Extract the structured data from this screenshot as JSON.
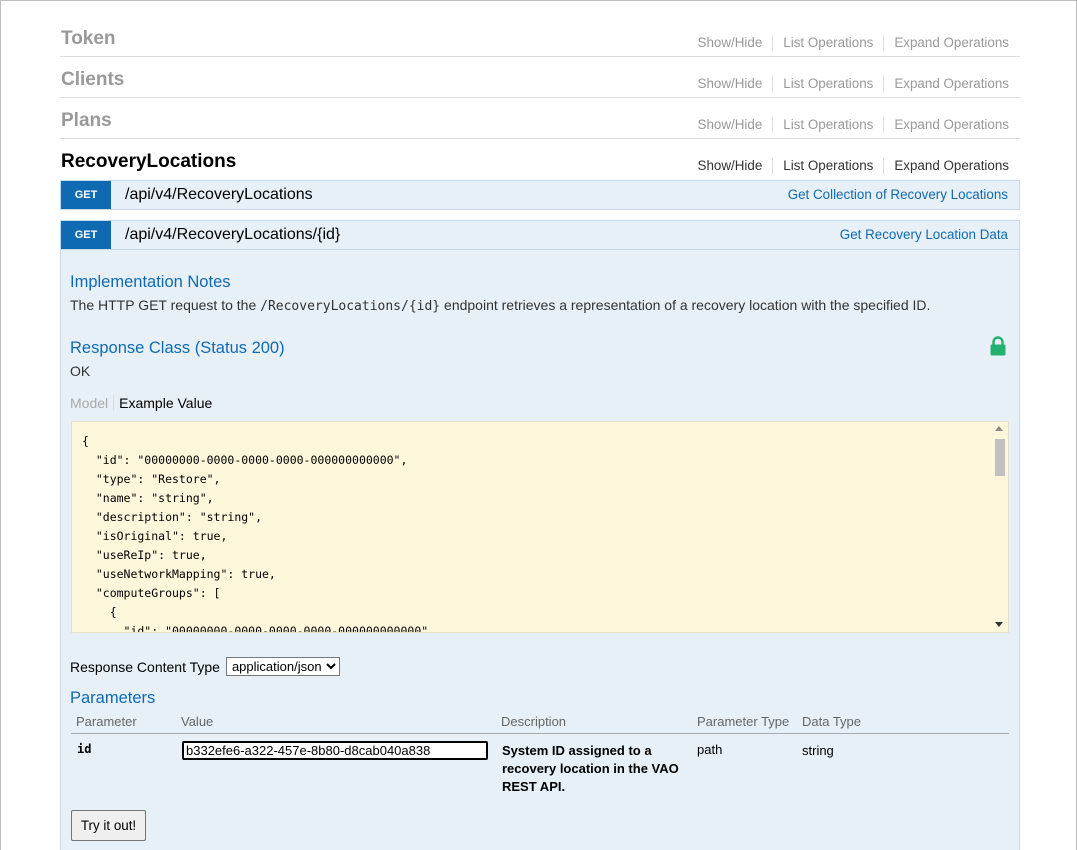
{
  "resources": [
    {
      "name": "Token",
      "active": false
    },
    {
      "name": "Clients",
      "active": false
    },
    {
      "name": "Plans",
      "active": false
    },
    {
      "name": "RecoveryLocations",
      "active": true
    }
  ],
  "resource_actions": {
    "show_hide": "Show/Hide",
    "list_operations": "List Operations",
    "expand_operations": "Expand Operations"
  },
  "operations": [
    {
      "method": "GET",
      "path": "/api/v4/RecoveryLocations",
      "summary": "Get Collection of Recovery Locations"
    },
    {
      "method": "GET",
      "path": "/api/v4/RecoveryLocations/{id}",
      "summary": "Get Recovery Location Data"
    }
  ],
  "implementation": {
    "title": "Implementation Notes",
    "text_before": "The HTTP GET request to the ",
    "code": "/RecoveryLocations/{id}",
    "text_after": " endpoint retrieves a representation of a recovery location with the specified ID."
  },
  "response_class": {
    "title": "Response Class (Status 200)",
    "status_text": "OK"
  },
  "tabs": {
    "model": "Model",
    "example": "Example Value"
  },
  "example_json": "{\n  \"id\": \"00000000-0000-0000-0000-000000000000\",\n  \"type\": \"Restore\",\n  \"name\": \"string\",\n  \"description\": \"string\",\n  \"isOriginal\": true,\n  \"useReIp\": true,\n  \"useNetworkMapping\": true,\n  \"computeGroups\": [\n    {\n      \"id\": \"00000000-0000-0000-0000-000000000000\",",
  "response_content_type": {
    "label": "Response Content Type",
    "selected": "application/json"
  },
  "parameters": {
    "title": "Parameters",
    "headers": [
      "Parameter",
      "Value",
      "Description",
      "Parameter Type",
      "Data Type"
    ],
    "rows": [
      {
        "name": "id",
        "value": "b332efe6-a322-457e-8b80-d8cab040a838",
        "description": "System ID assigned to a recovery location in the VAO REST API.",
        "param_type": "path",
        "data_type": "string"
      }
    ]
  },
  "try_button": "Try it out!",
  "colors": {
    "get_method": "#0f6ab4",
    "op_background": "#e7f0f7",
    "code_background": "#fcf6db",
    "lock": "#24b070"
  }
}
